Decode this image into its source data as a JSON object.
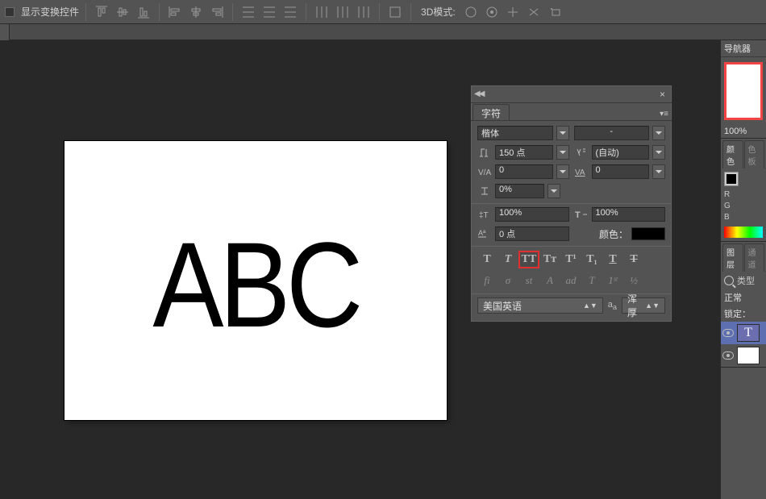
{
  "optbar": {
    "show_controls_label": "显示变换控件",
    "mode3d_label": "3D模式:"
  },
  "canvas": {
    "text": "ABC"
  },
  "char_panel": {
    "tab_label": "字符",
    "font_family": "楷体",
    "font_style": "-",
    "font_size": "150 点",
    "leading": "(自动)",
    "kerning": "0",
    "tracking": "0",
    "vscale_pct": "0%",
    "width_pct": "100%",
    "height_pct": "100%",
    "baseline": "0 点",
    "color_label": "颜色：",
    "style_buttons": {
      "bold": "T",
      "italic": "T",
      "allcaps": "TT",
      "smallcaps": "Tᴛ",
      "super": "T¹",
      "sub": "T₁",
      "underline": "T",
      "strike": "T"
    },
    "opentype": {
      "fi": "fi",
      "sigma": "σ",
      "st": "st",
      "a_script": "A",
      "aa_arrow": "ad",
      "t_alt": "T",
      "first": "1ˢᵗ",
      "half": "½"
    },
    "language": "美国英语",
    "aa_label": "浑厚"
  },
  "right_dock": {
    "nav_title": "导航器",
    "zoom": "100%",
    "color_tab": "颜色",
    "swatch_tab": "色板",
    "rgb": {
      "r": "R",
      "g": "G",
      "b": "B"
    },
    "layers_tab": "图层",
    "channels_tab": "通道",
    "type_label": "类型",
    "mode": "正常",
    "lock_label": "锁定："
  }
}
